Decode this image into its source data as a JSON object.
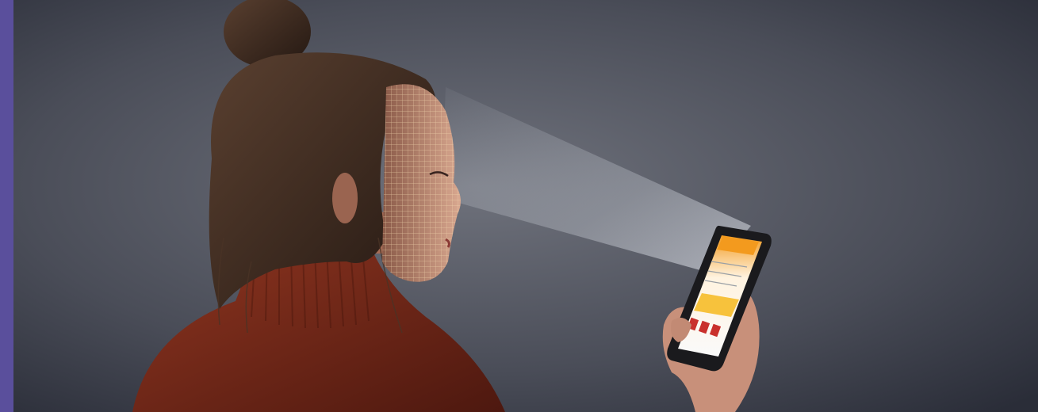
{
  "image": {
    "subject": "woman-face-scan-phone",
    "colors": {
      "accent_bar": "#5a4f9c",
      "background_light": "#6b6e78",
      "background_dark": "#2a2d38",
      "sweater": "#7a2a1a",
      "hair": "#3a2a20",
      "skin": "#c99580",
      "scan_grid": "#f4d9b0",
      "phone_screen_accent": "#f39a1e"
    }
  }
}
